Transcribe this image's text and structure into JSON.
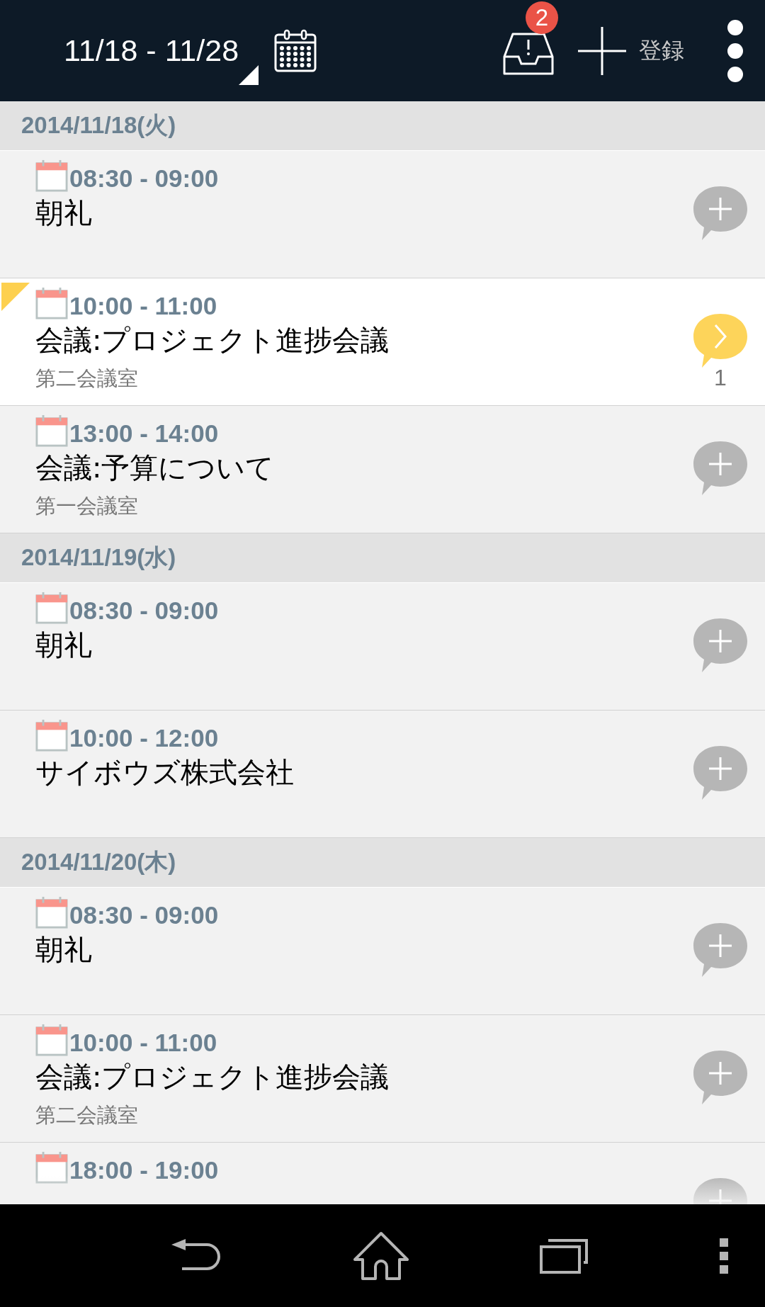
{
  "header": {
    "date_range": "11/18 - 11/28",
    "notification_count": "2",
    "register_label": "登録"
  },
  "days": [
    {
      "date": "2014/11/18(火)",
      "events": [
        {
          "time": "08:30 - 09:00",
          "title": "朝礼",
          "unread": false,
          "comment": {
            "kind": "add"
          }
        },
        {
          "time": "10:00 - 11:00",
          "title": "会議:プロジェクト進捗会議",
          "location": "第二会議室",
          "unread": true,
          "comment": {
            "kind": "view",
            "count": "1"
          }
        },
        {
          "time": "13:00 - 14:00",
          "title": "会議:予算について",
          "location": "第一会議室",
          "unread": false,
          "comment": {
            "kind": "add"
          }
        }
      ]
    },
    {
      "date": "2014/11/19(水)",
      "events": [
        {
          "time": "08:30 - 09:00",
          "title": "朝礼",
          "unread": false,
          "comment": {
            "kind": "add"
          }
        },
        {
          "time": "10:00 - 12:00",
          "title": "サイボウズ株式会社",
          "unread": false,
          "comment": {
            "kind": "add"
          }
        }
      ]
    },
    {
      "date": "2014/11/20(木)",
      "events": [
        {
          "time": "08:30 - 09:00",
          "title": "朝礼",
          "unread": false,
          "comment": {
            "kind": "add"
          }
        },
        {
          "time": "10:00 - 11:00",
          "title": "会議:プロジェクト進捗会議",
          "location": "第二会議室",
          "unread": false,
          "comment": {
            "kind": "add"
          }
        },
        {
          "time": "18:00 - 19:00",
          "unread": false,
          "comment": {
            "kind": "add"
          }
        }
      ]
    }
  ]
}
